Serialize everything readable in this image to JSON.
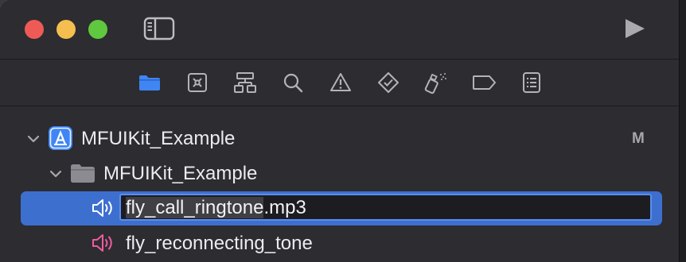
{
  "titlebar": {
    "traffic_lights": {
      "close_color": "#ee5b56",
      "minimize_color": "#f4bf4f",
      "maximize_color": "#5fc83f"
    },
    "sidebar_toggle_icon": "sidebar-icon",
    "run_icon": "play-icon"
  },
  "navigator_tabs": [
    {
      "icon": "folder-icon",
      "active": true
    },
    {
      "icon": "source-control-icon",
      "active": false
    },
    {
      "icon": "symbol-hierarchy-icon",
      "active": false
    },
    {
      "icon": "search-icon",
      "active": false
    },
    {
      "icon": "warning-icon",
      "active": false
    },
    {
      "icon": "test-diamond-icon",
      "active": false
    },
    {
      "icon": "debug-spray-icon",
      "active": false
    },
    {
      "icon": "tag-icon",
      "active": false
    },
    {
      "icon": "report-list-icon",
      "active": false
    }
  ],
  "accent_color": "#3d6fcf",
  "tree": {
    "project": {
      "label": "MFUIKit_Example",
      "badge": "M",
      "icon": "xcode-app-icon"
    },
    "group": {
      "label": "MFUIKit_Example",
      "icon": "folder-icon"
    },
    "editing_item": {
      "name_selected": "fly_call_ringtone",
      "extension": ".mp3",
      "icon": "audio-speaker-icon"
    },
    "next_item": {
      "label": "fly_reconnecting_tone",
      "icon": "audio-speaker-icon"
    }
  }
}
